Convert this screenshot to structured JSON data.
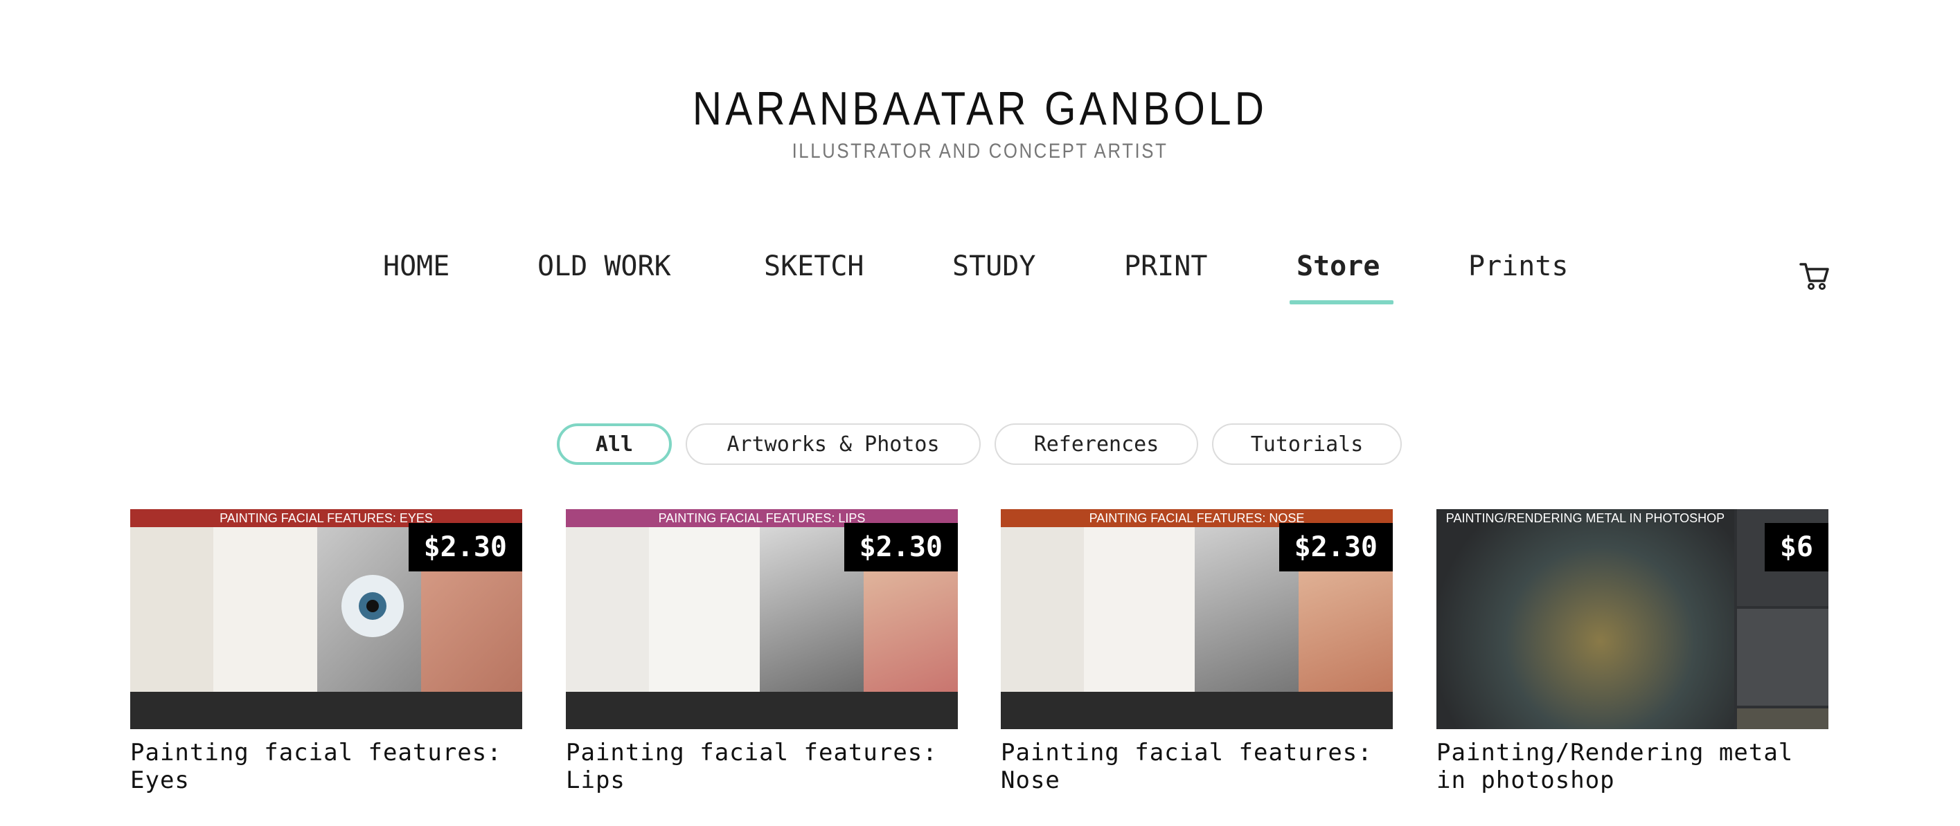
{
  "header": {
    "title": "NARANBAATAR GANBOLD",
    "subtitle": "ILLUSTRATOR AND CONCEPT ARTIST"
  },
  "nav": {
    "items": [
      {
        "label": "HOME"
      },
      {
        "label": "OLD WORK"
      },
      {
        "label": "SKETCH"
      },
      {
        "label": "STUDY"
      },
      {
        "label": "PRINT"
      },
      {
        "label": "Store",
        "active": true
      },
      {
        "label": "Prints"
      }
    ],
    "cart_icon": "shopping-cart-icon",
    "accent_color": "#7fd6c4"
  },
  "filters": {
    "items": [
      {
        "label": "All",
        "active": true
      },
      {
        "label": "Artworks & Photos"
      },
      {
        "label": "References"
      },
      {
        "label": "Tutorials"
      }
    ]
  },
  "products": [
    {
      "title": "Painting facial features: Eyes",
      "price": "$2.30",
      "banner": "PAINTING FACIAL FEATURES: EYES",
      "banner_color": "#a8302a"
    },
    {
      "title": "Painting facial features: Lips",
      "price": "$2.30",
      "banner": "PAINTING FACIAL FEATURES: LIPS",
      "banner_color": "#a6457e"
    },
    {
      "title": "Painting facial features: Nose",
      "price": "$2.30",
      "banner": "PAINTING FACIAL FEATURES: NOSE",
      "banner_color": "#b4461f"
    },
    {
      "title": "Painting/Rendering metal in photoshop",
      "price": "$6",
      "banner": "PAINTING/RENDERING METAL IN PHOTOSHOP",
      "banner_color": "#2a2c2e"
    }
  ]
}
